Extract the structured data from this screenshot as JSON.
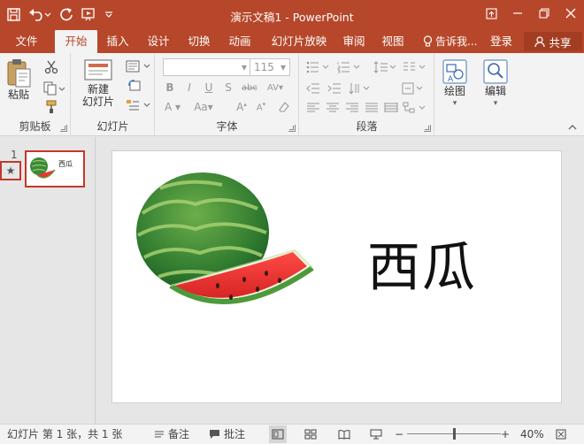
{
  "titlebar": {
    "doc_name": "演示文稿1",
    "separator": " - ",
    "app_name": "PowerPoint"
  },
  "tabs": [
    {
      "label": "文件"
    },
    {
      "label": "开始",
      "active": true
    },
    {
      "label": "插入"
    },
    {
      "label": "设计"
    },
    {
      "label": "切换"
    },
    {
      "label": "动画"
    },
    {
      "label": "幻灯片放映"
    },
    {
      "label": "审阅"
    },
    {
      "label": "视图"
    }
  ],
  "tell_me": "告诉我...",
  "login": "登录",
  "share": "共享",
  "ribbon": {
    "clipboard": {
      "paste": "粘贴",
      "label": "剪贴板"
    },
    "slides": {
      "new_line1": "新建",
      "new_line2": "幻灯片",
      "label": "幻灯片"
    },
    "font": {
      "size": "115",
      "label": "字体"
    },
    "paragraph": {
      "label": "段落"
    },
    "drawing": {
      "label": "绘图"
    },
    "editing": {
      "label": "编辑"
    }
  },
  "thumbnails": {
    "slide_number": "1",
    "thumb_title": "西瓜"
  },
  "slide": {
    "title": "西瓜"
  },
  "status": {
    "slide_info": "幻灯片 第 1 张，共 1 张",
    "notes": "备注",
    "comments": "批注",
    "zoom": "40%",
    "zoom_fraction": 0.5
  },
  "colors": {
    "accent": "#b7472a",
    "thumb_highlight": "#c0392b"
  }
}
